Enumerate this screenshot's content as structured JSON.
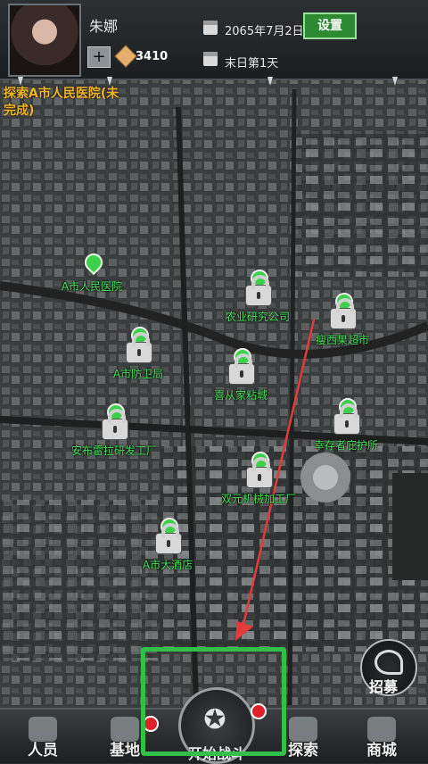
{
  "player": {
    "name": "朱娜",
    "coins": "3410"
  },
  "info": {
    "date": "2065年7月2日",
    "day": "末日第1天"
  },
  "buttons": {
    "settings": "设置",
    "plus": "+"
  },
  "quest": {
    "text": "探索A市人民医院(未完成)"
  },
  "locations": [
    {
      "name": "A市人民医院",
      "locked": false
    },
    {
      "name": "农业研究公司",
      "locked": true
    },
    {
      "name": "瘦西果超市",
      "locked": true
    },
    {
      "name": "A市防卫局",
      "locked": true
    },
    {
      "name": "喜从家粘城",
      "locked": true
    },
    {
      "name": "安布雷拉研发工厂",
      "locked": true
    },
    {
      "name": "幸存者庇护所",
      "locked": true
    },
    {
      "name": "双元机械加工厂",
      "locked": true
    },
    {
      "name": "A市大酒店",
      "locked": true
    }
  ],
  "recruit": {
    "label": "招募"
  },
  "nav": {
    "members": "人员",
    "base": "基地",
    "start": "开始战斗",
    "explore": "探索",
    "shop": "商城"
  },
  "colors": {
    "accent": "#31c04a",
    "quest": "#f1b526",
    "arrow": "#e23b3b"
  }
}
